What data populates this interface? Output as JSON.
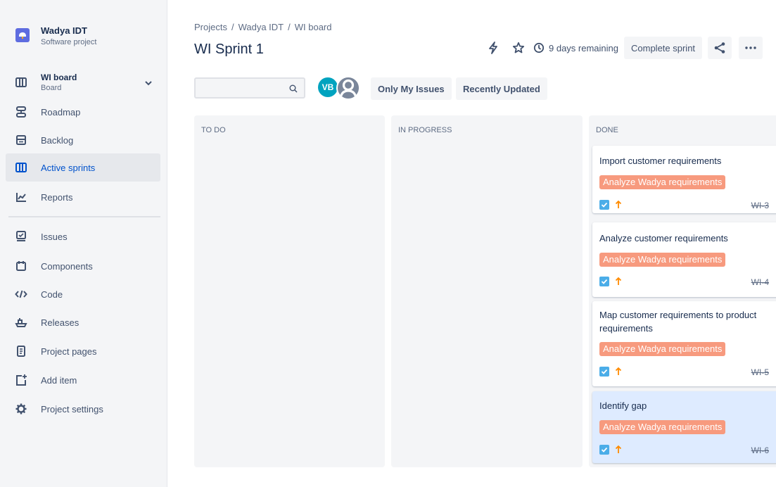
{
  "project": {
    "name": "Wadya IDT",
    "type": "Software project"
  },
  "sidebar": {
    "board": {
      "label": "WI board",
      "sublabel": "Board"
    },
    "items_top": [
      {
        "label": "Roadmap",
        "icon": "roadmap-icon"
      },
      {
        "label": "Backlog",
        "icon": "backlog-icon"
      },
      {
        "label": "Active sprints",
        "icon": "active-sprints-icon",
        "active": true
      },
      {
        "label": "Reports",
        "icon": "reports-icon"
      }
    ],
    "items_bottom": [
      {
        "label": "Issues",
        "icon": "issues-icon"
      },
      {
        "label": "Components",
        "icon": "components-icon"
      },
      {
        "label": "Code",
        "icon": "code-icon"
      },
      {
        "label": "Releases",
        "icon": "releases-icon"
      },
      {
        "label": "Project pages",
        "icon": "pages-icon"
      },
      {
        "label": "Add item",
        "icon": "add-item-icon"
      },
      {
        "label": "Project settings",
        "icon": "settings-icon"
      }
    ]
  },
  "breadcrumb": {
    "items": [
      "Projects",
      "Wadya IDT",
      "WI board"
    ],
    "separator": "/"
  },
  "header": {
    "title": "WI Sprint 1",
    "remaining": "9 days remaining",
    "complete_label": "Complete sprint"
  },
  "toolbar": {
    "search_placeholder": "",
    "avatar_initials": "VB",
    "only_my_issues": "Only My Issues",
    "recently_updated": "Recently Updated"
  },
  "columns": [
    {
      "title": "TO DO",
      "cards": []
    },
    {
      "title": "IN PROGRESS",
      "cards": []
    },
    {
      "title": "DONE",
      "cards": [
        {
          "summary": "Import customer requirements",
          "epic": "Analyze Wadya requirements",
          "key": "WI-3",
          "type": "task",
          "priority": "high"
        },
        {
          "summary": "Analyze customer requirements",
          "epic": "Analyze Wadya requirements",
          "key": "WI-4",
          "type": "task",
          "priority": "high"
        },
        {
          "summary": "Map customer requirements to product requirements",
          "epic": "Analyze Wadya requirements",
          "key": "WI-5",
          "type": "task",
          "priority": "high"
        },
        {
          "summary": "Identify gap",
          "epic": "Analyze Wadya requirements",
          "key": "WI-6",
          "type": "task",
          "priority": "high",
          "selected": true
        }
      ]
    }
  ],
  "colors": {
    "accent": "#0052cc",
    "epic_badge": "#f79a7e",
    "task_check": "#4bade8",
    "priority_high": "#ff8b00",
    "avatar_vb": "#00a3bf",
    "selected_card": "#deebff"
  }
}
